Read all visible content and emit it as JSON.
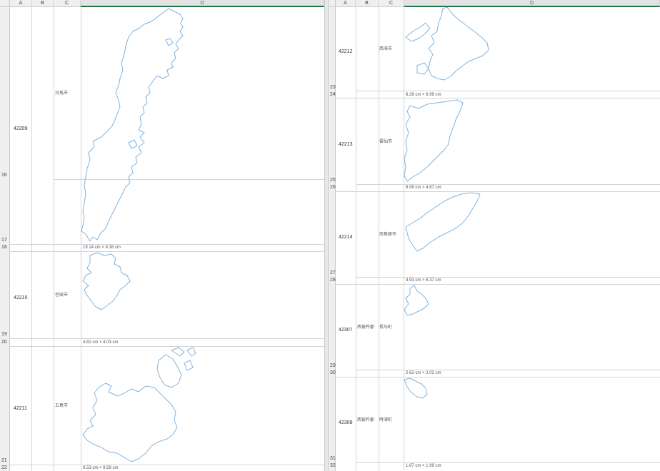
{
  "left": {
    "columns": [
      "A",
      "B",
      "C",
      "D"
    ],
    "active_column": "D",
    "row_numbers": [
      "16",
      "17",
      "18",
      "19",
      "20",
      "21",
      "22"
    ],
    "entries": [
      {
        "code": "42209",
        "prefecture": "",
        "city": "対馬市",
        "size": "19.14 cm × 8.38 cm"
      },
      {
        "code": "42210",
        "prefecture": "",
        "city": "壱岐市",
        "size": "4.82 cm × 4.03 cm"
      },
      {
        "code": "42211",
        "prefecture": "",
        "city": "五島市",
        "size": "9.53 cm × 9.58 cm"
      }
    ]
  },
  "right": {
    "columns": [
      "A",
      "B",
      "C",
      "D"
    ],
    "active_column": "D",
    "row_numbers": [
      "23",
      "24",
      "25",
      "26",
      "27",
      "28",
      "29",
      "30",
      "31",
      "32"
    ],
    "entries": [
      {
        "code": "42212",
        "prefecture": "",
        "city": "西海市",
        "size": "6.28 cm × 6.99 cm"
      },
      {
        "code": "42213",
        "prefecture": "",
        "city": "雲仙市",
        "size": "6.99 cm × 4.87 cm"
      },
      {
        "code": "42214",
        "prefecture": "",
        "city": "南島原市",
        "size": "4.93 cm × 6.37 cm"
      },
      {
        "code": "42307",
        "prefecture": "西彼杵郡",
        "city": "長与町",
        "size": "2.62 cm × 2.02 cm"
      },
      {
        "code": "42308",
        "prefecture": "西彼杵郡",
        "city": "時津町",
        "size": "1.87 cm × 1.99 cm"
      }
    ]
  },
  "colors": {
    "map_outline": "#7fb3e0",
    "active_header": "#217346",
    "grid": "#d4d4d4",
    "header_bg": "#efefef"
  }
}
